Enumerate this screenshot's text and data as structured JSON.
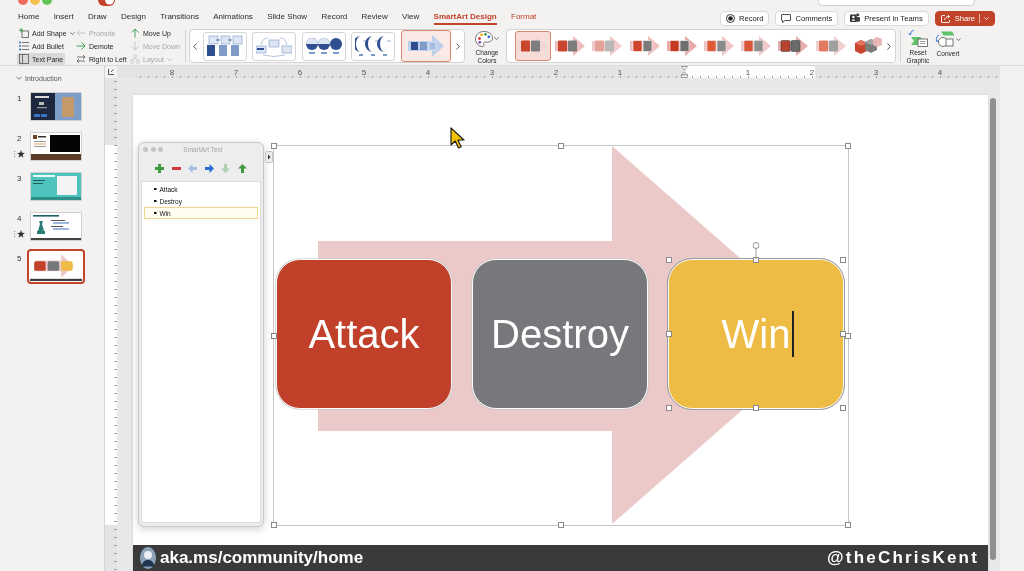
{
  "title_bar": {
    "autosave_on": true
  },
  "tabs": [
    {
      "label": "Home",
      "selected": false,
      "contextual": false
    },
    {
      "label": "Insert",
      "selected": false,
      "contextual": false
    },
    {
      "label": "Draw",
      "selected": false,
      "contextual": false
    },
    {
      "label": "Design",
      "selected": false,
      "contextual": false
    },
    {
      "label": "Transitions",
      "selected": false,
      "contextual": false
    },
    {
      "label": "Animations",
      "selected": false,
      "contextual": false
    },
    {
      "label": "Slide Show",
      "selected": false,
      "contextual": false
    },
    {
      "label": "Record",
      "selected": false,
      "contextual": false
    },
    {
      "label": "Review",
      "selected": false,
      "contextual": false
    },
    {
      "label": "View",
      "selected": false,
      "contextual": false
    },
    {
      "label": "SmartArt Design",
      "selected": true,
      "contextual": true
    },
    {
      "label": "Format",
      "selected": false,
      "contextual": true
    }
  ],
  "header_buttons": [
    {
      "kind": "record",
      "label": "Record"
    },
    {
      "kind": "comments",
      "label": "Comments"
    },
    {
      "kind": "teams",
      "label": "Present in Teams"
    },
    {
      "kind": "share",
      "label": "Share"
    }
  ],
  "ribbon": {
    "command_columns": [
      [
        {
          "kind": "add_shape",
          "label": "Add Shape",
          "disabled": false,
          "selected": false,
          "dropdown": true
        },
        {
          "kind": "add_bullet",
          "label": "Add Bullet",
          "disabled": false,
          "selected": false,
          "dropdown": false
        },
        {
          "kind": "text_pane",
          "label": "Text Pane",
          "disabled": false,
          "selected": true,
          "dropdown": false
        }
      ],
      [
        {
          "kind": "promote",
          "label": "Promote",
          "disabled": true,
          "selected": false,
          "dropdown": false
        },
        {
          "kind": "demote",
          "label": "Demote",
          "disabled": false,
          "selected": false,
          "dropdown": false
        },
        {
          "kind": "right_to_left",
          "label": "Right to Left",
          "disabled": false,
          "selected": false,
          "dropdown": false
        }
      ],
      [
        {
          "kind": "move_up",
          "label": "Move Up",
          "disabled": false,
          "selected": false,
          "dropdown": false
        },
        {
          "kind": "move_down",
          "label": "Move Down",
          "disabled": true,
          "selected": false,
          "dropdown": false
        },
        {
          "kind": "layout",
          "label": "Layout",
          "disabled": true,
          "selected": false,
          "dropdown": true
        }
      ]
    ],
    "layout_gallery": [
      {
        "kind": "blocks",
        "selected": false
      },
      {
        "kind": "linked",
        "selected": false
      },
      {
        "kind": "circles",
        "selected": false
      },
      {
        "kind": "arcs",
        "selected": false
      },
      {
        "kind": "arrow",
        "selected": true
      }
    ],
    "change_colors": {
      "label": "Change Colors"
    },
    "style_gallery": [
      {
        "kind": "flat",
        "selected": true
      },
      {
        "kind": "subtle",
        "selected": false
      },
      {
        "kind": "light",
        "selected": false
      },
      {
        "kind": "moderate",
        "selected": false
      },
      {
        "kind": "intense",
        "selected": false
      },
      {
        "kind": "polished",
        "selected": false
      },
      {
        "kind": "sheen",
        "selected": false
      },
      {
        "kind": "inset",
        "selected": false
      },
      {
        "kind": "soft",
        "selected": false
      },
      {
        "kind": "cubes",
        "selected": false
      }
    ],
    "reset_graphic": {
      "label": "Reset Graphic"
    },
    "convert": {
      "label": "Convert"
    }
  },
  "ruler": {
    "left_labels": [
      "8",
      "7",
      "6",
      "5",
      "4",
      "3",
      "2",
      "1"
    ],
    "right_labels": [
      "1",
      "2",
      "3",
      "4"
    ]
  },
  "sidebar": {
    "section": {
      "title": "Introduction",
      "expanded": true
    },
    "slides": [
      {
        "number": "1",
        "kind": "title",
        "starred": false,
        "selected": false
      },
      {
        "number": "2",
        "kind": "video",
        "starred": true,
        "selected": false
      },
      {
        "number": "3",
        "kind": "teal",
        "starred": false,
        "selected": false
      },
      {
        "number": "4",
        "kind": "tips",
        "starred": true,
        "selected": false
      },
      {
        "number": "5",
        "kind": "smartart",
        "starred": false,
        "selected": true
      }
    ]
  },
  "text_pane": {
    "title": "SmartArt Text",
    "tools": [
      {
        "kind": "add",
        "disabled": false
      },
      {
        "kind": "remove",
        "disabled": false
      },
      {
        "kind": "promote",
        "disabled": true
      },
      {
        "kind": "demote",
        "disabled": false
      },
      {
        "kind": "move_down",
        "disabled": true
      },
      {
        "kind": "move_up",
        "disabled": false
      }
    ],
    "items": [
      {
        "text": "Attack",
        "selected": false
      },
      {
        "text": "Destroy",
        "selected": false
      },
      {
        "text": "Win",
        "selected": true
      }
    ]
  },
  "smartart": {
    "shapes": [
      {
        "text": "Attack",
        "color": "#c0402a",
        "selected": false
      },
      {
        "text": "Destroy",
        "color": "#77787b",
        "selected": false
      },
      {
        "text": "Win",
        "color": "#eebb45",
        "selected": true
      }
    ]
  },
  "footer": {
    "link": "aka.ms/community/home",
    "handle": "@theChrisKent"
  }
}
